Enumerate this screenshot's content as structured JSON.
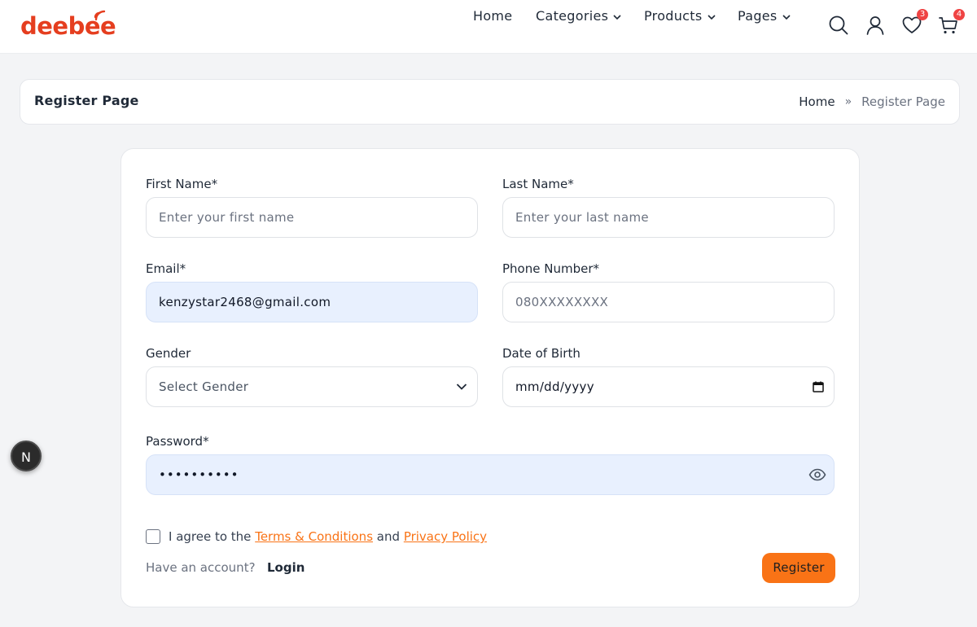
{
  "brand": {
    "name": "deebee",
    "color": "#e53e1f",
    "accent": "#f97316"
  },
  "nav": {
    "home": "Home",
    "categories": "Categories",
    "products": "Products",
    "pages": "Pages"
  },
  "header_icons": {
    "search": "search-icon",
    "user": "user-icon",
    "wishlist": "heart-icon",
    "wishlist_count": "3",
    "cart": "cart-icon",
    "cart_count": "4"
  },
  "breadcrumb": {
    "title": "Register Page",
    "home": "Home",
    "separator": "»",
    "current": "Register Page"
  },
  "form": {
    "first_name": {
      "label": "First Name*",
      "placeholder": "Enter your first name",
      "value": ""
    },
    "last_name": {
      "label": "Last Name*",
      "placeholder": "Enter your last name",
      "value": ""
    },
    "email": {
      "label": "Email*",
      "value": "kenzystar2468@gmail.com"
    },
    "phone": {
      "label": "Phone Number*",
      "placeholder": "080XXXXXXXX",
      "value": ""
    },
    "gender": {
      "label": "Gender",
      "selected": "Select Gender"
    },
    "dob": {
      "label": "Date of Birth",
      "value": "mm/dd/yyyy"
    },
    "password": {
      "label": "Password*",
      "value": "••••••••••"
    },
    "agree_prefix": "I agree to the",
    "terms": "Terms & Conditions",
    "and": "and",
    "privacy": "Privacy Policy",
    "have_account": "Have an account?",
    "login": "Login",
    "register": "Register"
  },
  "floating": {
    "avatar_letter": "N"
  }
}
